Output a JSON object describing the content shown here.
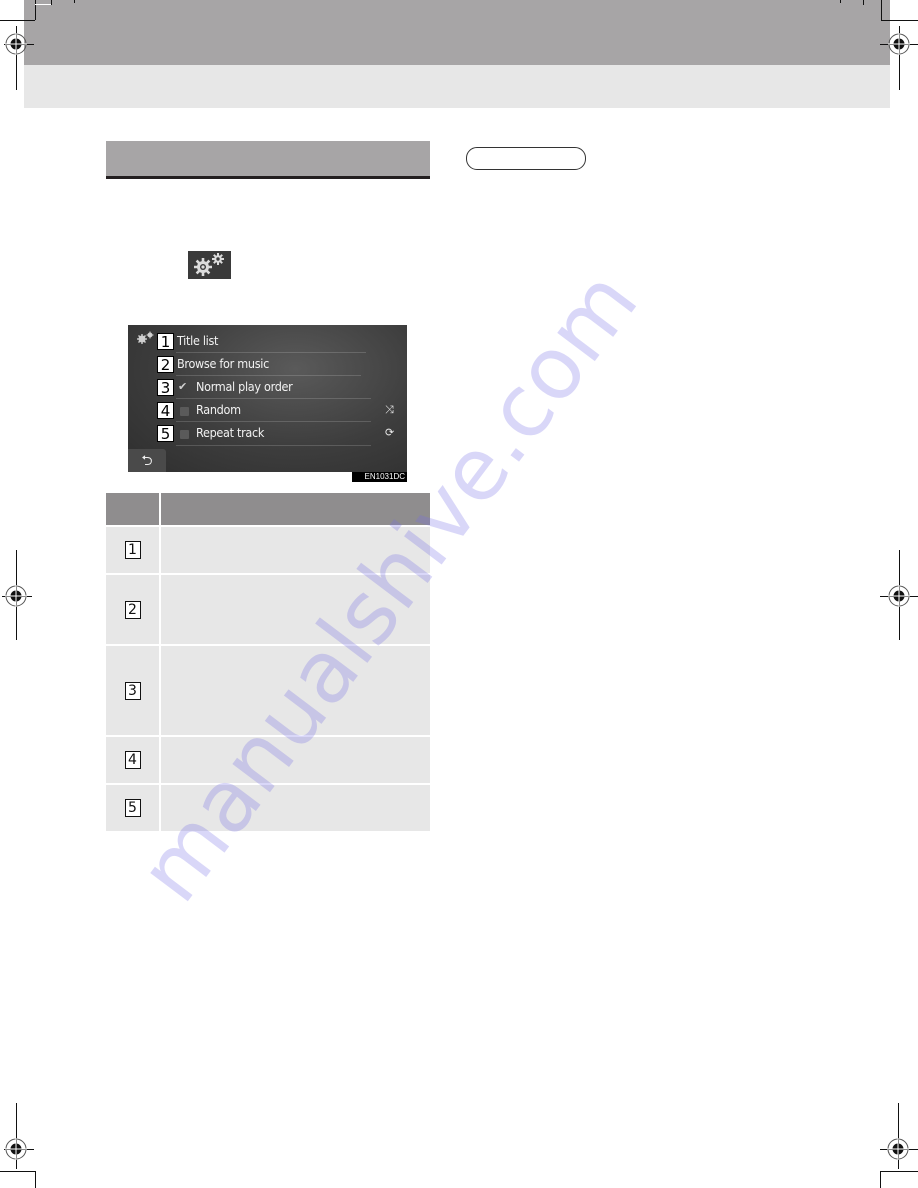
{
  "page": {
    "section_heading": "",
    "pill_label": ""
  },
  "screen": {
    "menu": [
      {
        "callout": "1",
        "label": "Title list",
        "checkbox": "none",
        "right_icon": ""
      },
      {
        "callout": "2",
        "label": "Browse for music",
        "checkbox": "none",
        "right_icon": ""
      },
      {
        "callout": "3",
        "label": "Normal play order",
        "checkbox": "checked",
        "right_icon": ""
      },
      {
        "callout": "4",
        "label": "Random",
        "checkbox": "unchecked",
        "right_icon": "shuffle-icon"
      },
      {
        "callout": "5",
        "label": "Repeat track",
        "checkbox": "unchecked",
        "right_icon": "repeat-icon"
      }
    ],
    "back_glyph": "⮌",
    "figure_code": "EN1031DC"
  },
  "table": {
    "headers": {
      "no": "",
      "description": ""
    },
    "rows": [
      {
        "no": "1",
        "description": ""
      },
      {
        "no": "2",
        "description": ""
      },
      {
        "no": "3",
        "description": ""
      },
      {
        "no": "4",
        "description": ""
      },
      {
        "no": "5",
        "description": ""
      }
    ]
  },
  "icons": {
    "check": "✔",
    "shuffle": "⤨",
    "repeat": "⟳"
  },
  "watermark": "manualshive.com",
  "colors": {
    "header_dark": "#a7a5a6",
    "header_light": "#e7e7e7",
    "table_head": "#8f8d8e",
    "table_body": "#e7e7e7",
    "watermark": "#b4adf0"
  }
}
